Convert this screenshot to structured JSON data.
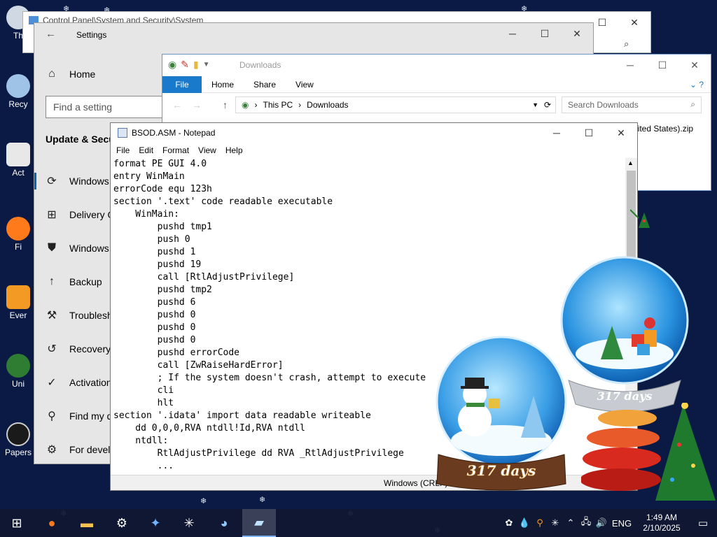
{
  "control_panel": {
    "title": "Control Panel\\System and Security\\System"
  },
  "settings": {
    "title": "Settings",
    "home_label": "Home",
    "search_placeholder": "Find a setting",
    "section_title": "Update & Secu",
    "nav": [
      {
        "label": "Windows",
        "icon": "refresh-icon"
      },
      {
        "label": "Delivery O",
        "icon": "delivery-icon"
      },
      {
        "label": "Windows",
        "icon": "shield-icon"
      },
      {
        "label": "Backup",
        "icon": "backup-icon"
      },
      {
        "label": "Troublesho",
        "icon": "wrench-icon"
      },
      {
        "label": "Recovery",
        "icon": "recovery-icon"
      },
      {
        "label": "Activation",
        "icon": "check-circle-icon"
      },
      {
        "label": "Find my d",
        "icon": "locate-icon"
      },
      {
        "label": "For develo",
        "icon": "developer-icon"
      }
    ]
  },
  "explorer": {
    "title": "Downloads",
    "tabs": [
      "File",
      "Home",
      "Share",
      "View"
    ],
    "address": {
      "root": "This PC",
      "folder": "Downloads"
    },
    "search_placeholder": "Search Downloads",
    "file_name": "nited States).zip"
  },
  "notepad": {
    "title": "BSOD.ASM - Notepad",
    "menu": [
      "File",
      "Edit",
      "Format",
      "View",
      "Help"
    ],
    "content": "format PE GUI 4.0\nentry WinMain\nerrorCode equ 123h\nsection '.text' code readable executable\n    WinMain:\n        pushd tmp1\n        push 0\n        pushd 1\n        pushd 19\n        call [RtlAdjustPrivilege]\n        pushd tmp2\n        pushd 6\n        pushd 0\n        pushd 0\n        pushd 0\n        pushd errorCode\n        call [ZwRaiseHardError]\n        ; If the system doesn't crash, attempt to execute                  rti\n        cli\n        hlt\nsection '.idata' import data readable writeable\n    dd 0,0,0,RVA ntdll!Id,RVA ntdll\n    ntdll:\n        RtlAdjustPrivilege dd RVA _RtlAdjustPrivilege\n        ...",
    "status_text": "Windows (CRLF)"
  },
  "gadgets": {
    "globe_days_1": "317 days",
    "globe_days_2": "317 days"
  },
  "desktop": {
    "icons": [
      {
        "label": "Th",
        "icon": "this-pc-icon"
      },
      {
        "label": "Recy",
        "icon": "recycle-bin-icon"
      },
      {
        "label": "Act",
        "icon": "activate-icon"
      },
      {
        "label": "Fi",
        "icon": "firefox-icon"
      },
      {
        "label": "Ever",
        "icon": "everything-icon"
      },
      {
        "label": "Uni",
        "icon": "uninstall-icon"
      },
      {
        "label": "Papers",
        "icon": "papers-icon"
      }
    ]
  },
  "taskbar": {
    "apps": [
      "start-icon",
      "firefox-icon",
      "file-explorer-icon",
      "settings-gear-icon",
      "app-icon",
      "asterisk-icon",
      "globe-icon",
      "notepad-icon"
    ],
    "language": "ENG",
    "time": "1:49 AM",
    "date": "2/10/2025"
  },
  "colors": {
    "desktop_bg": "#0b1a45",
    "accent": "#1979ca",
    "taskbar": "#101830"
  }
}
